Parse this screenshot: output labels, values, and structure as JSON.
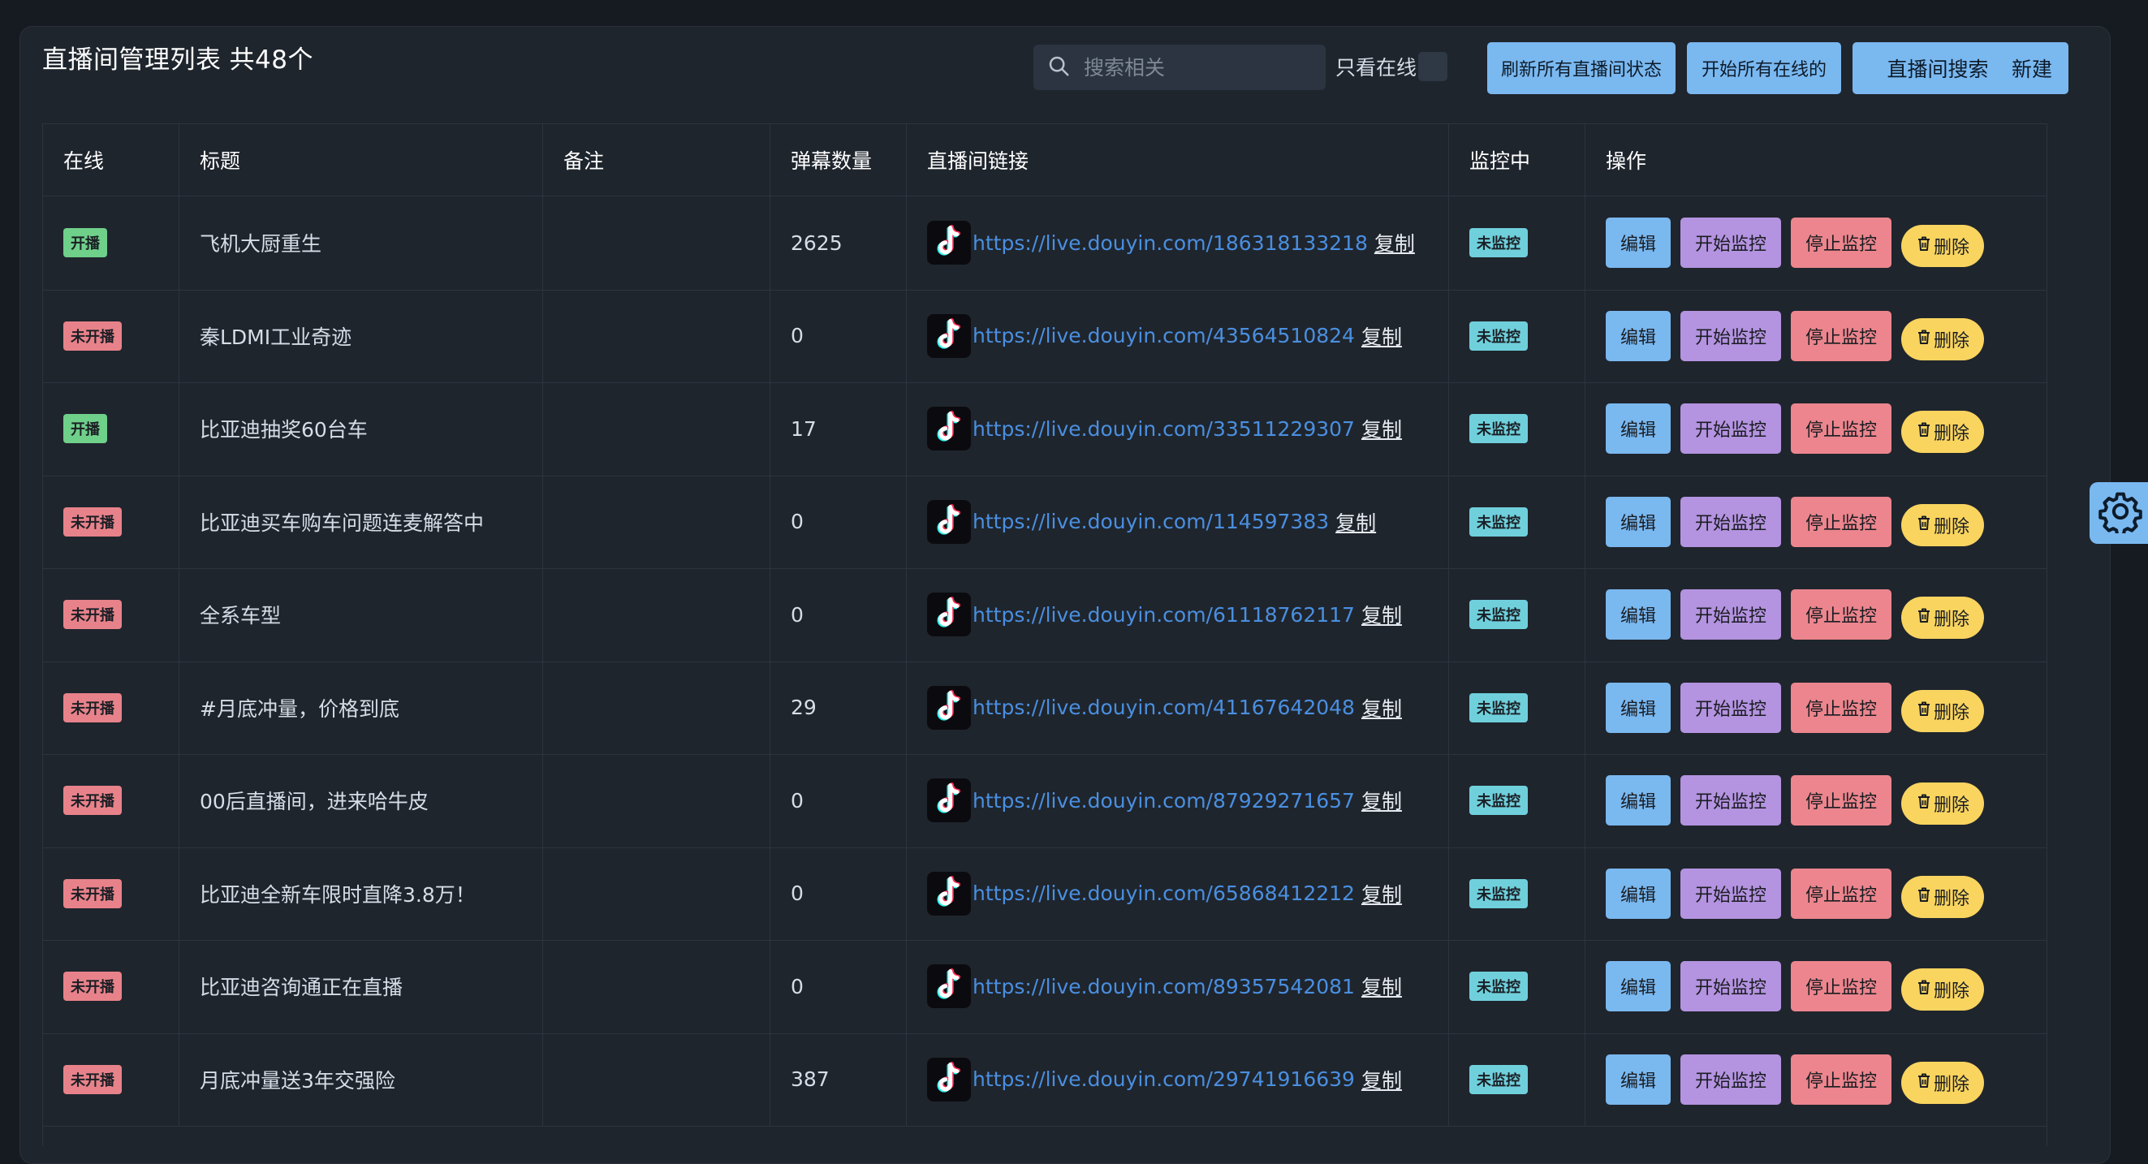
{
  "header": {
    "title": "直播间管理列表",
    "count": "共48个"
  },
  "search": {
    "placeholder": "搜索相关",
    "value": ""
  },
  "online_only_label": "只看在线",
  "toolbar": {
    "refresh_label": "刷新所有直播间状态",
    "start_all_label": "开始所有在线的",
    "search_label": "直播间搜索",
    "new_label": "新建"
  },
  "columns": [
    "在线",
    "标题",
    "备注",
    "弹幕数量",
    "直播间链接",
    "监控中",
    "操作"
  ],
  "actions": {
    "edit": "编辑",
    "start": "开始监控",
    "stop": "停止监控",
    "delete": "删除",
    "copy": "复制"
  },
  "rows": [
    {
      "status": "开播",
      "title": "飞机大厨重生",
      "note": "",
      "count": "2625",
      "url": "https://live.douyin.com/186318133218",
      "monitor": "未监控"
    },
    {
      "status": "未开播",
      "title": "秦LDMI工业奇迹",
      "note": "",
      "count": "0",
      "url": "https://live.douyin.com/43564510824",
      "monitor": "未监控"
    },
    {
      "status": "开播",
      "title": "比亚迪抽奖60台车",
      "note": "",
      "count": "17",
      "url": "https://live.douyin.com/33511229307",
      "monitor": "未监控"
    },
    {
      "status": "未开播",
      "title": "比亚迪买车购车问题连麦解答中",
      "note": "",
      "count": "0",
      "url": "https://live.douyin.com/114597383",
      "monitor": "未监控"
    },
    {
      "status": "未开播",
      "title": "全系车型",
      "note": "",
      "count": "0",
      "url": "https://live.douyin.com/61118762117",
      "monitor": "未监控"
    },
    {
      "status": "未开播",
      "title": "#月底冲量，价格到底",
      "note": "",
      "count": "29",
      "url": "https://live.douyin.com/41167642048",
      "monitor": "未监控"
    },
    {
      "status": "未开播",
      "title": "00后直播间，进来哈牛皮",
      "note": "",
      "count": "0",
      "url": "https://live.douyin.com/87929271657",
      "monitor": "未监控"
    },
    {
      "status": "未开播",
      "title": "比亚迪全新车限时直降3.8万！",
      "note": "",
      "count": "0",
      "url": "https://live.douyin.com/65868412212",
      "monitor": "未监控"
    },
    {
      "status": "未开播",
      "title": "比亚迪咨询通正在直播",
      "note": "",
      "count": "0",
      "url": "https://live.douyin.com/89357542081",
      "monitor": "未监控"
    },
    {
      "status": "未开播",
      "title": "月底冲量送3年交强险",
      "note": "",
      "count": "387",
      "url": "https://live.douyin.com/29741916639",
      "monitor": "未监控"
    }
  ],
  "colors": {
    "online": "#6fd08a",
    "offline": "#e8828a",
    "monitor": "#6fd0dc",
    "edit": "#7ab8f0",
    "start": "#b493e0",
    "stop": "#ec858d",
    "delete": "#f9d45f",
    "link": "#4a8fe0"
  },
  "icons": {
    "search": "search-icon",
    "platform": "tiktok-icon",
    "delete": "trash-icon",
    "settings": "gear-icon"
  }
}
